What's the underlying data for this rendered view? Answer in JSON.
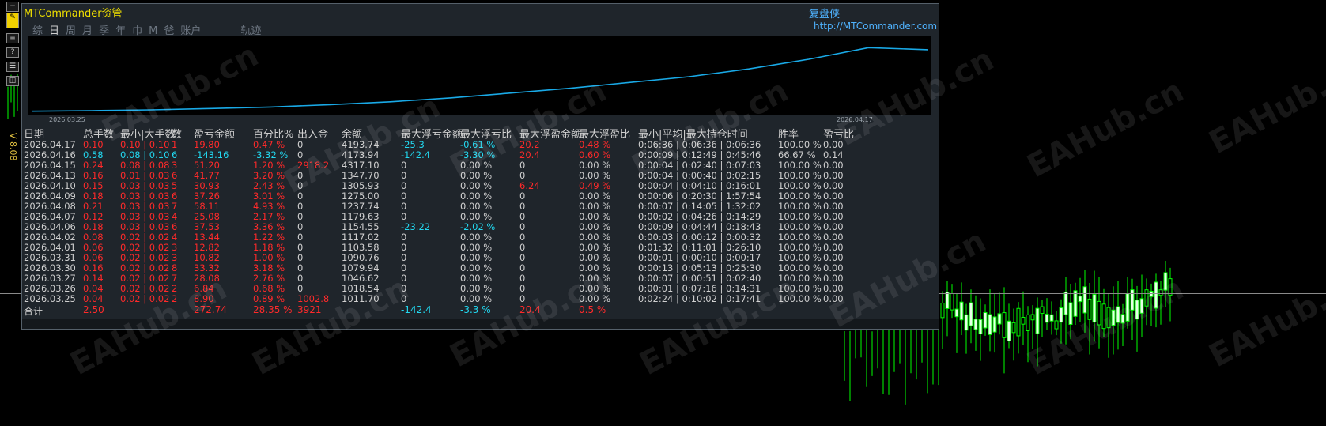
{
  "app": {
    "title": "MTCommander资管",
    "brand": "复盘侠",
    "url": "http://MTCommander.com",
    "version": "V 8.08"
  },
  "tabs": [
    "综",
    "日",
    "周",
    "月",
    "季",
    "年",
    "巾",
    "M",
    "爸",
    "账户",
    "轨迹"
  ],
  "active_tab": "日",
  "equity_chart": {
    "start_date": "2026.03.25",
    "end_date": "2026.04.17",
    "values": [
      1011.7,
      1018.54,
      1046.62,
      1079.94,
      1090.76,
      1103.58,
      1117.02,
      1154.55,
      1179.63,
      1237.74,
      1275.0,
      1305.93,
      1347.7,
      4317.1,
      4173.94,
      4193.74
    ]
  },
  "watermark": "EAHub.cn",
  "headers": [
    "日期",
    "总手数",
    "最小|大手数",
    "数",
    "盈亏金额",
    "百分比%",
    "出入金",
    "余额",
    "最大浮亏金额",
    "最大浮亏比",
    "最大浮盈金额",
    "最大浮盈比",
    "最小|平均|最大持仓时间",
    "胜率",
    "盈亏比"
  ],
  "rows": [
    [
      "2026.04.17",
      "0.10",
      "0.10 | 0.10",
      "1",
      "19.80",
      "0.47 %",
      "0",
      "4193.74",
      "-25.3",
      "-0.61 %",
      "20.2",
      "0.48 %",
      "0:06:36 | 0:06:36 | 0:06:36",
      "100.00 %",
      "0.00"
    ],
    [
      "2026.04.16",
      "0.58",
      "0.08 | 0.10",
      "6",
      "-143.16",
      "-3.32 %",
      "0",
      "4173.94",
      "-142.4",
      "-3.30 %",
      "20.4",
      "0.60 %",
      "0:00:09 | 0:12:49 | 0:45:46",
      "66.67 %",
      "0.14"
    ],
    [
      "2026.04.15",
      "0.24",
      "0.08 | 0.08",
      "3",
      "51.20",
      "1.20 %",
      "2918.2",
      "4317.10",
      "0",
      "0.00 %",
      "0",
      "0.00 %",
      "0:00:04 | 0:02:40 | 0:07:03",
      "100.00 %",
      "0.00"
    ],
    [
      "2026.04.13",
      "0.16",
      "0.01 | 0.03",
      "6",
      "41.77",
      "3.20 %",
      "0",
      "1347.70",
      "0",
      "0.00 %",
      "0",
      "0.00 %",
      "0:00:04 | 0:00:40 | 0:02:15",
      "100.00 %",
      "0.00"
    ],
    [
      "2026.04.10",
      "0.15",
      "0.03 | 0.03",
      "5",
      "30.93",
      "2.43 %",
      "0",
      "1305.93",
      "0",
      "0.00 %",
      "6.24",
      "0.49 %",
      "0:00:04 | 0:04:10 | 0:16:01",
      "100.00 %",
      "0.00"
    ],
    [
      "2026.04.09",
      "0.18",
      "0.03 | 0.03",
      "6",
      "37.26",
      "3.01 %",
      "0",
      "1275.00",
      "0",
      "0.00 %",
      "0",
      "0.00 %",
      "0:00:06 | 0:20:30 | 1:57:54",
      "100.00 %",
      "0.00"
    ],
    [
      "2026.04.08",
      "0.21",
      "0.03 | 0.03",
      "7",
      "58.11",
      "4.93 %",
      "0",
      "1237.74",
      "0",
      "0.00 %",
      "0",
      "0.00 %",
      "0:00:07 | 0:14:05 | 1:32:02",
      "100.00 %",
      "0.00"
    ],
    [
      "2026.04.07",
      "0.12",
      "0.03 | 0.03",
      "4",
      "25.08",
      "2.17 %",
      "0",
      "1179.63",
      "0",
      "0.00 %",
      "0",
      "0.00 %",
      "0:00:02 | 0:04:26 | 0:14:29",
      "100.00 %",
      "0.00"
    ],
    [
      "2026.04.06",
      "0.18",
      "0.03 | 0.03",
      "6",
      "37.53",
      "3.36 %",
      "0",
      "1154.55",
      "-23.22",
      "-2.02 %",
      "0",
      "0.00 %",
      "0:00:09 | 0:04:44 | 0:18:43",
      "100.00 %",
      "0.00"
    ],
    [
      "2026.04.02",
      "0.08",
      "0.02 | 0.02",
      "4",
      "13.44",
      "1.22 %",
      "0",
      "1117.02",
      "0",
      "0.00 %",
      "0",
      "0.00 %",
      "0:00:03 | 0:00:12 | 0:00:32",
      "100.00 %",
      "0.00"
    ],
    [
      "2026.04.01",
      "0.06",
      "0.02 | 0.02",
      "3",
      "12.82",
      "1.18 %",
      "0",
      "1103.58",
      "0",
      "0.00 %",
      "0",
      "0.00 %",
      "0:01:32 | 0:11:01 | 0:26:10",
      "100.00 %",
      "0.00"
    ],
    [
      "2026.03.31",
      "0.06",
      "0.02 | 0.02",
      "3",
      "10.82",
      "1.00 %",
      "0",
      "1090.76",
      "0",
      "0.00 %",
      "0",
      "0.00 %",
      "0:00:01 | 0:00:10 | 0:00:17",
      "100.00 %",
      "0.00"
    ],
    [
      "2026.03.30",
      "0.16",
      "0.02 | 0.02",
      "8",
      "33.32",
      "3.18 %",
      "0",
      "1079.94",
      "0",
      "0.00 %",
      "0",
      "0.00 %",
      "0:00:13 | 0:05:13 | 0:25:30",
      "100.00 %",
      "0.00"
    ],
    [
      "2026.03.27",
      "0.14",
      "0.02 | 0.02",
      "7",
      "28.08",
      "2.76 %",
      "0",
      "1046.62",
      "0",
      "0.00 %",
      "0",
      "0.00 %",
      "0:00:07 | 0:00:51 | 0:02:40",
      "100.00 %",
      "0.00"
    ],
    [
      "2026.03.26",
      "0.04",
      "0.02 | 0.02",
      "2",
      "6.84",
      "0.68 %",
      "0",
      "1018.54",
      "0",
      "0.00 %",
      "0",
      "0.00 %",
      "0:00:01 | 0:07:16 | 0:14:31",
      "100.00 %",
      "0.00"
    ],
    [
      "2026.03.25",
      "0.04",
      "0.02 | 0.02",
      "2",
      "8.90",
      "0.89 %",
      "1002.8",
      "1011.70",
      "0",
      "0.00 %",
      "0",
      "0.00 %",
      "0:02:24 | 0:10:02 | 0:17:41",
      "100.00 %",
      "0.00"
    ]
  ],
  "totals": {
    "label": "合计",
    "lots": "2.50",
    "pnl": "272.74",
    "pct": "28.35 %",
    "flow": "3921",
    "maxloss": "-142.4",
    "maxloss_pct": "-3.3 %",
    "maxgain": "20.4",
    "maxgain_pct": "0.5 %"
  },
  "colors": {
    "profit": "#ff2a2a",
    "loss": "#22d8f0",
    "equity_line": "#19a9e6",
    "title": "#f0e000",
    "brand": "#4fb3ff"
  }
}
